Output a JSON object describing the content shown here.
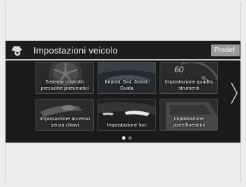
{
  "header": {
    "title": "Impostazioni veicolo",
    "default_button": "Predef."
  },
  "tiles": [
    {
      "label_lines": [
        "Sistema controllo",
        "pressione pneumatici"
      ],
      "icon": "wheel-image"
    },
    {
      "label_lines": [
        "Impost. Sist. Assist.",
        "Guida"
      ],
      "icon": "driver-assist-image"
    },
    {
      "label_lines": [
        "Impostazione quadro",
        "strumenti"
      ],
      "icon": "gauge-image",
      "gauge_text": "60"
    },
    {
      "label_lines": [
        "Impostazione accesso",
        "senza chiavi"
      ],
      "icon": "key-fob-image"
    },
    {
      "label_lines": [
        "Impostazione luci"
      ],
      "icon": "headlights-image"
    },
    {
      "label_lines": [
        "Impostazione",
        "porte/finestrini"
      ],
      "icon": "door-image"
    }
  ],
  "pagination": {
    "current": 1,
    "total": 2
  },
  "colors": {
    "screen_bg": "#1a1a1a",
    "button_bg": "#9a9a9a",
    "divider": "#c9c9c9",
    "text": "#f2f2f2"
  }
}
